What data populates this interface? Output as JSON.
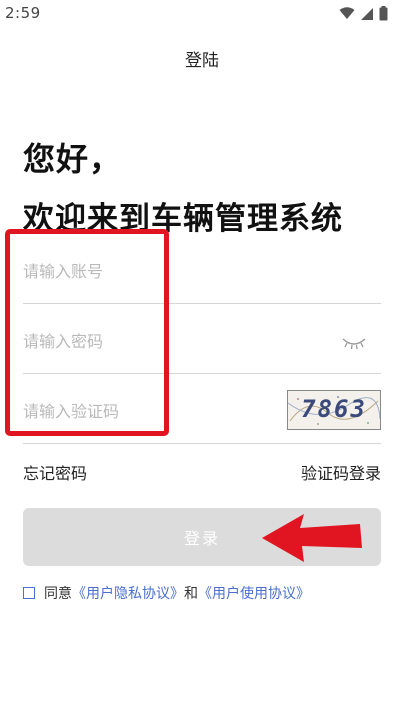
{
  "status_bar": {
    "time": "2:59",
    "icons": [
      "wifi-icon",
      "signal-icon",
      "battery-icon"
    ]
  },
  "header": {
    "title": "登陆"
  },
  "greeting": {
    "line1": "您好，",
    "line2": "欢迎来到车辆管理系统"
  },
  "form": {
    "account": {
      "placeholder": "请输入账号",
      "value": ""
    },
    "password": {
      "placeholder": "请输入密码",
      "value": ""
    },
    "captcha": {
      "placeholder": "请输入验证码",
      "value": "",
      "image_text": "7863"
    }
  },
  "links": {
    "forgot_password": "忘记密码",
    "code_login": "验证码登录"
  },
  "login_button": {
    "label": "登录"
  },
  "agreement": {
    "prefix": "同意",
    "user_agreement": "《用户隐私协议》",
    "conjunction": "和",
    "usage_agreement": "《用户使用协议》",
    "checked": false
  },
  "colors": {
    "annotation_red": "#e01521",
    "link_blue": "#4a6fd0",
    "button_disabled": "#dcdcdc",
    "divider": "#d6d6d6"
  }
}
